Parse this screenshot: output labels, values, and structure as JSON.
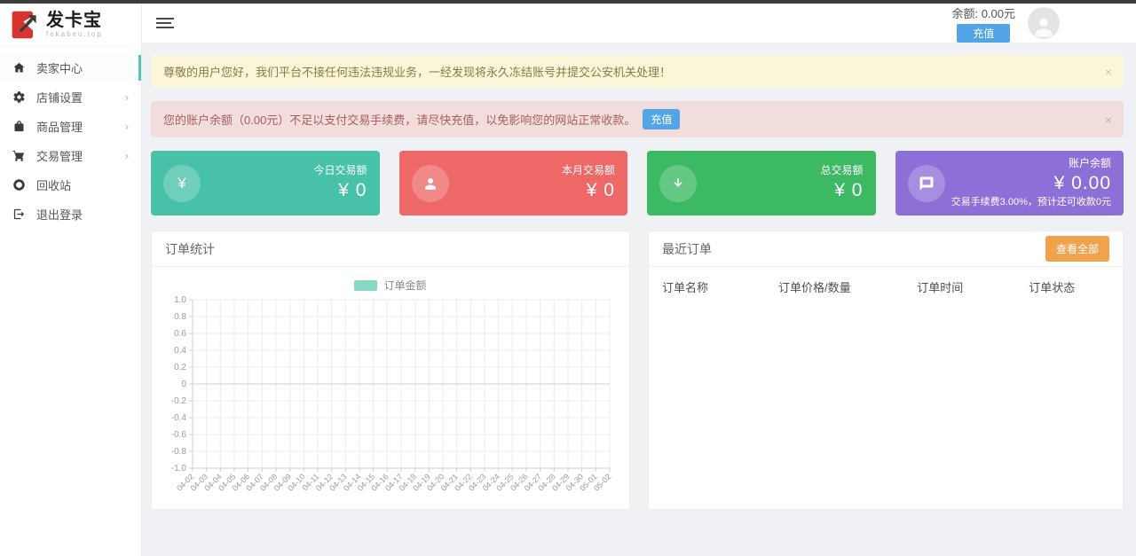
{
  "sidebar": {
    "logo": {
      "title": "发卡宝",
      "subtitle": "fekabeo.top"
    },
    "items": [
      {
        "label": "卖家中心",
        "icon": "home-icon",
        "active": true,
        "has_submenu": false
      },
      {
        "label": "店铺设置",
        "icon": "gear-icon",
        "active": false,
        "has_submenu": true
      },
      {
        "label": "商品管理",
        "icon": "bag-icon",
        "active": false,
        "has_submenu": true
      },
      {
        "label": "交易管理",
        "icon": "cart-icon",
        "active": false,
        "has_submenu": true
      },
      {
        "label": "回收站",
        "icon": "recycle-icon",
        "active": false,
        "has_submenu": false
      },
      {
        "label": "退出登录",
        "icon": "logout-icon",
        "active": false,
        "has_submenu": false
      }
    ],
    "submenu_arrow": "›"
  },
  "header": {
    "balance_label": "余额: 0.00元",
    "recharge_label": "充值"
  },
  "alerts": [
    {
      "type": "warning",
      "text": "尊敬的用户您好，我们平台不接任何违法违规业务，一经发现将永久冻结账号并提交公安机关处理！",
      "close": "×"
    },
    {
      "type": "danger",
      "text": "您的账户余额（0.00元）不足以支付交易手续费，请尽快充值，以免影响您的网站正常收款。",
      "button": "充值",
      "close": "×"
    }
  ],
  "stat_cards": [
    {
      "label": "今日交易额",
      "value": "¥ 0",
      "color": "#47c2a8",
      "icon": "yen-icon"
    },
    {
      "label": "本月交易额",
      "value": "¥ 0",
      "color": "#ee6867",
      "icon": "user-icon"
    },
    {
      "label": "总交易额",
      "value": "¥ 0",
      "color": "#3cb963",
      "icon": "arrow-down-icon"
    },
    {
      "label": "账户余额",
      "value": "¥ 0.00",
      "color": "#8d6fd8",
      "icon": "comment-icon",
      "note": "交易手续费3.00%，预计还可收款0元"
    }
  ],
  "order_stats_panel": {
    "title": "订单统计"
  },
  "chart_data": {
    "type": "line",
    "title": "订单统计",
    "legend": [
      {
        "label": "订单金额",
        "color": "#86d8c4"
      }
    ],
    "legend_position": "top-center",
    "x": [
      "04-02",
      "04-03",
      "04-04",
      "04-05",
      "04-06",
      "04-07",
      "04-08",
      "04-09",
      "04-10",
      "04-11",
      "04-12",
      "04-13",
      "04-14",
      "04-15",
      "04-16",
      "04-17",
      "04-18",
      "04-19",
      "04-20",
      "04-21",
      "04-22",
      "04-23",
      "04-24",
      "04-25",
      "04-26",
      "04-27",
      "04-28",
      "04-29",
      "04-30",
      "05-01",
      "05-02"
    ],
    "series": [
      {
        "name": "订单金额",
        "values": []
      }
    ],
    "ylim": [
      -1.0,
      1.0
    ],
    "yticks": [
      "1.0",
      "0.8",
      "0.6",
      "0.4",
      "0.2",
      "0",
      "-0.2",
      "-0.4",
      "-0.6",
      "-0.8",
      "-1.0"
    ],
    "grid": true
  },
  "recent_orders_panel": {
    "title": "最近订单",
    "view_all_label": "查看全部",
    "columns": [
      "订单名称",
      "订单价格/数量",
      "订单时间",
      "订单状态"
    ],
    "rows": []
  }
}
